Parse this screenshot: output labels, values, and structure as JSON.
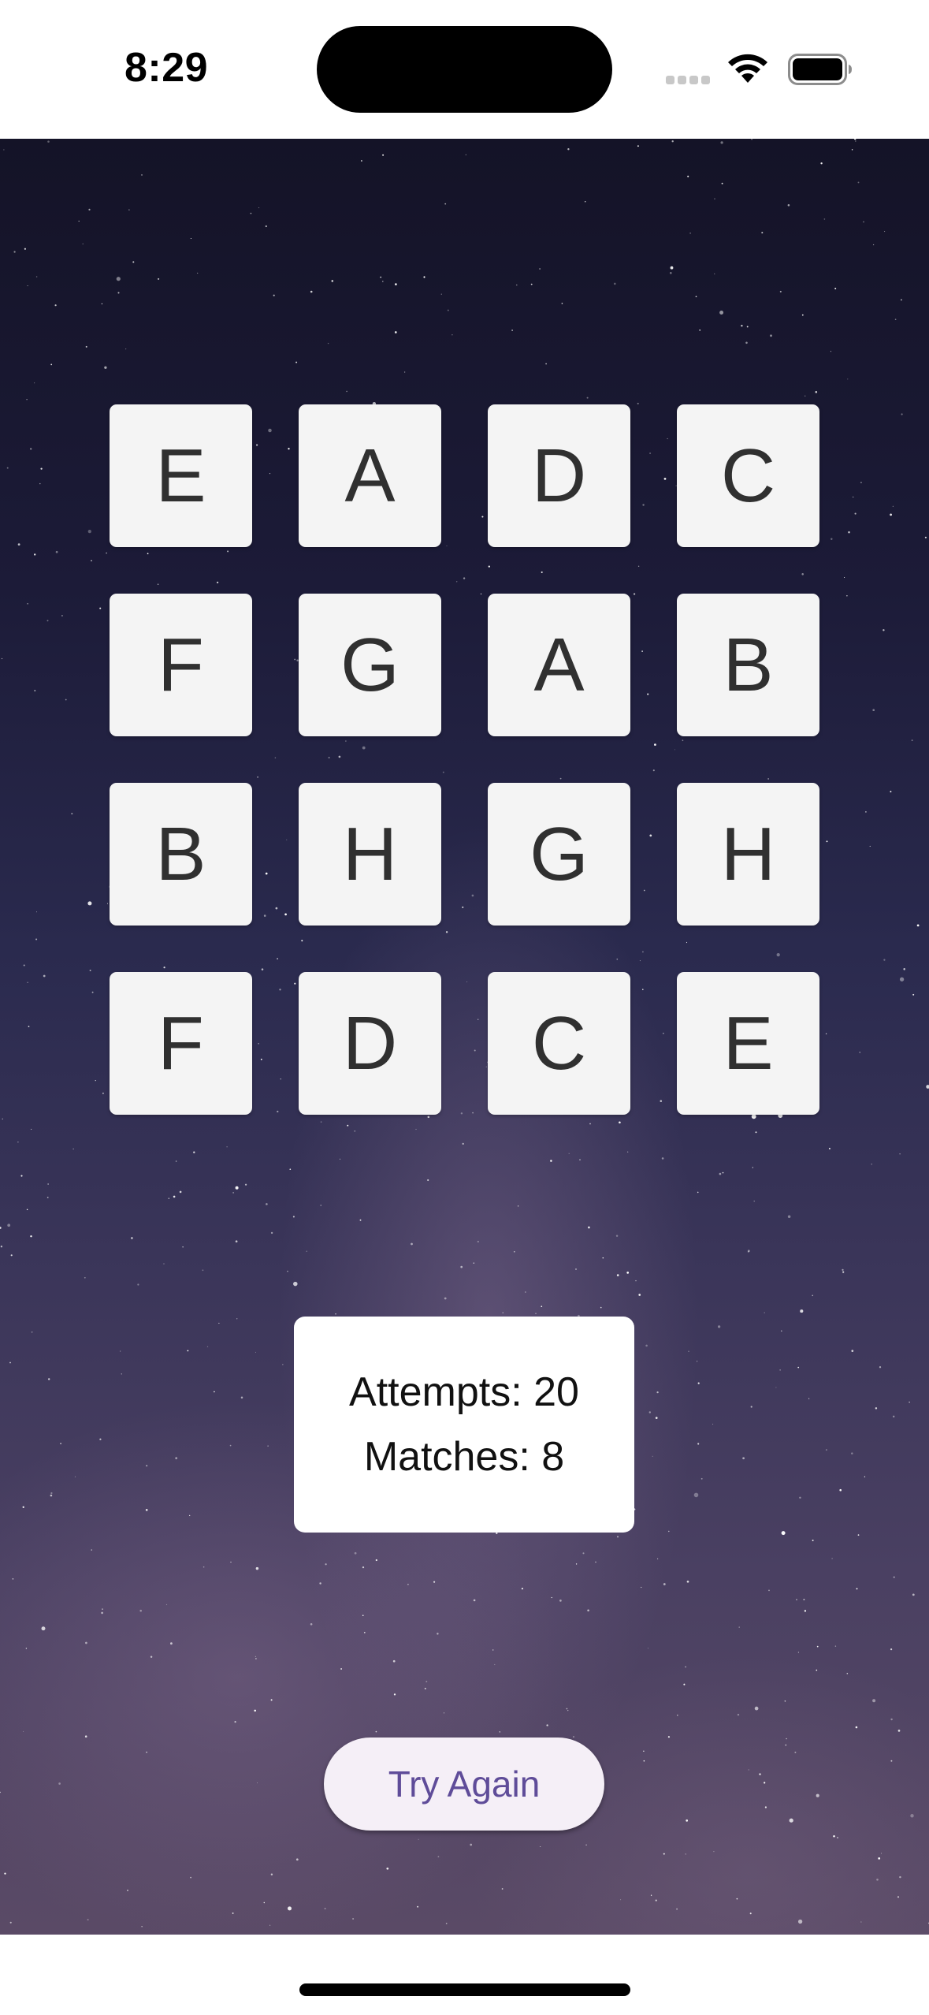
{
  "status_bar": {
    "time": "8:29"
  },
  "cards": [
    "E",
    "A",
    "D",
    "C",
    "F",
    "G",
    "A",
    "B",
    "B",
    "H",
    "G",
    "H",
    "F",
    "D",
    "C",
    "E"
  ],
  "score": {
    "attempts": "Attempts: 20",
    "matches": "Matches: 8"
  },
  "actions": {
    "try_again_label": "Try Again"
  },
  "colors": {
    "card_background": "#f4f4f4",
    "button_background": "#f5eff7",
    "button_text": "#5f4c99"
  }
}
